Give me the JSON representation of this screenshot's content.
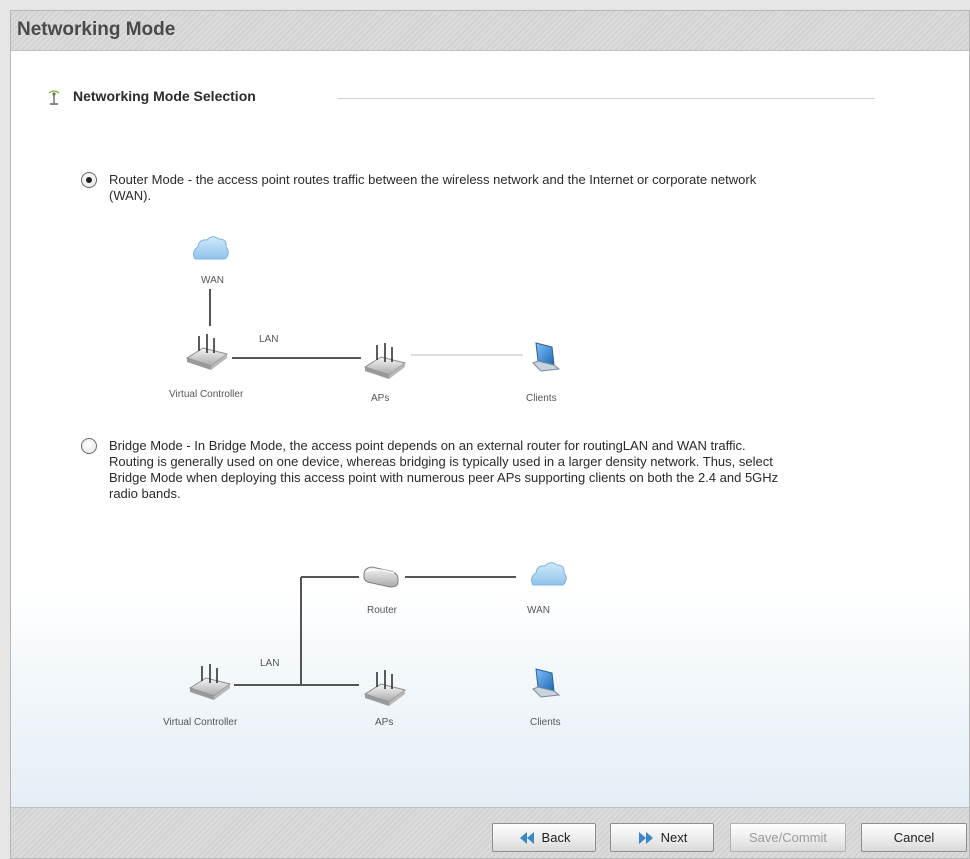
{
  "header": {
    "title": "Networking Mode"
  },
  "section": {
    "title": "Networking Mode Selection"
  },
  "options": [
    {
      "selected": true,
      "text": "Router Mode - the access point routes traffic between the wireless network and the Internet or corporate network (WAN)."
    },
    {
      "selected": false,
      "text": "Bridge Mode - In Bridge Mode, the access point depends on an external router for routingLAN and WAN traffic. Routing is generally used on one device, whereas bridging is typically used in a larger density network. Thus, select Bridge Mode when deploying this access point with numerous peer APs supporting clients on both the 2.4 and 5GHz radio bands."
    }
  ],
  "router_diagram": {
    "wan": "WAN",
    "lan": "LAN",
    "controller": "Virtual Controller",
    "aps": "APs",
    "clients": "Clients"
  },
  "bridge_diagram": {
    "router": "Router",
    "wan": "WAN",
    "lan": "LAN",
    "controller": "Virtual Controller",
    "aps": "APs",
    "clients": "Clients"
  },
  "footer": {
    "back": "Back",
    "next": "Next",
    "save": "Save/Commit",
    "cancel": "Cancel"
  },
  "colors": {
    "title_text": "#4a4a4a",
    "cloud": "#a9d3f2",
    "laptop_screen": "#2f7fd0",
    "arrow_blue": "#3a86c8"
  },
  "icons": {
    "section": "antenna-icon",
    "cloud": "cloud-icon",
    "access_point": "access-point-icon",
    "router": "router-icon",
    "laptop": "laptop-icon",
    "back": "double-left-arrow-icon",
    "next": "double-right-arrow-icon"
  }
}
